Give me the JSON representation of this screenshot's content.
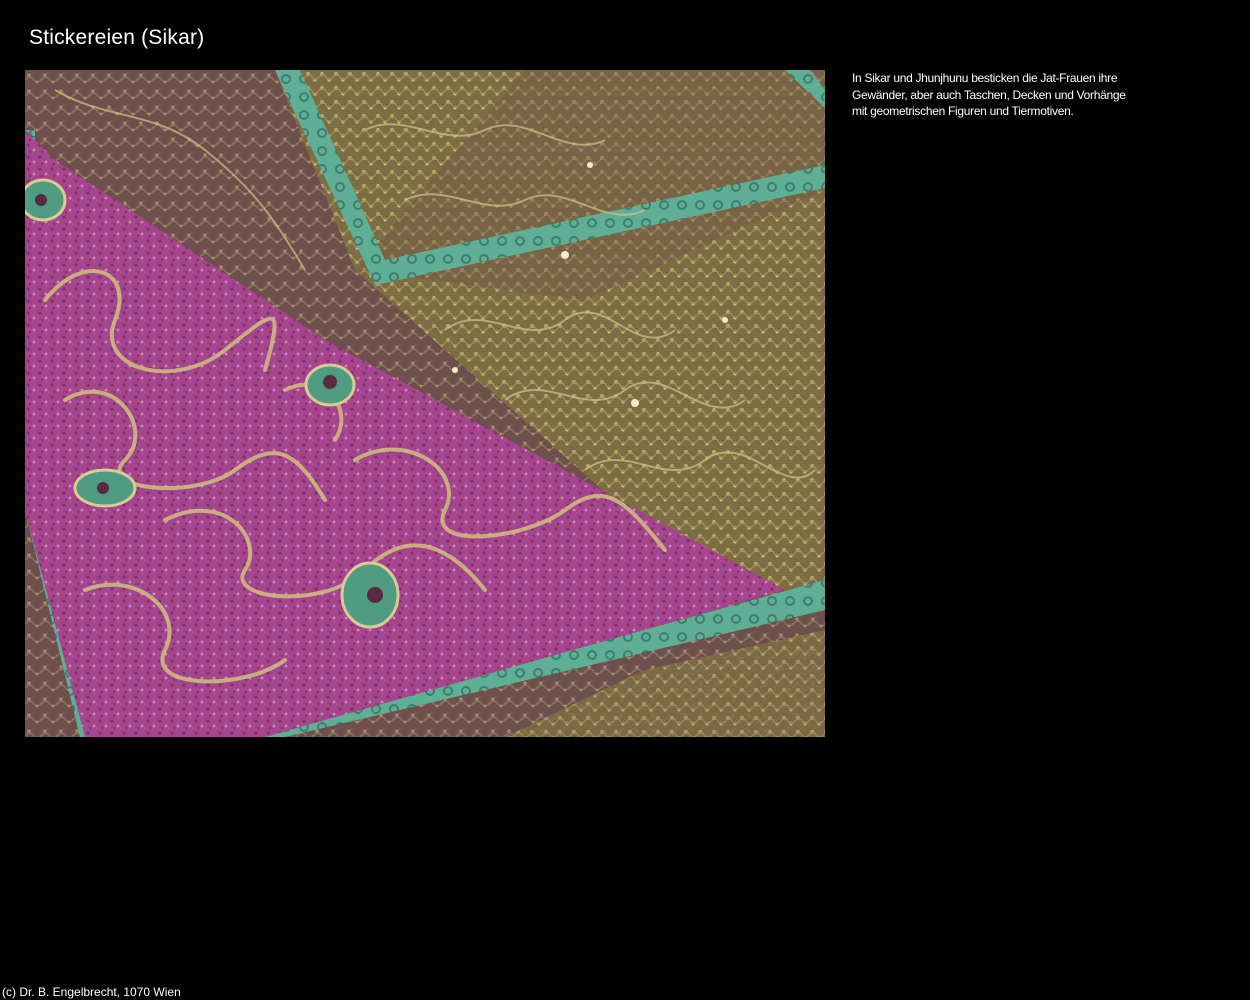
{
  "page": {
    "title": "Stickereien (Sikar)"
  },
  "caption": {
    "lines": [
      "In Sikar und Jhunjhunu besticken die Jat-Frauen ihre",
      "Gewänder, aber auch Taschen, Decken und Vorhänge",
      "mit geometrischen Figuren und Tiermotiven."
    ]
  },
  "footer": {
    "copyright": "(c) Dr. B. Engelbrecht, 1070 Wien"
  },
  "photo": {
    "colors": {
      "magenta": "#a8438f",
      "gold": "#8a7a4a",
      "rose_brown": "#7a5a58",
      "turquoise": "#5fae96"
    }
  }
}
